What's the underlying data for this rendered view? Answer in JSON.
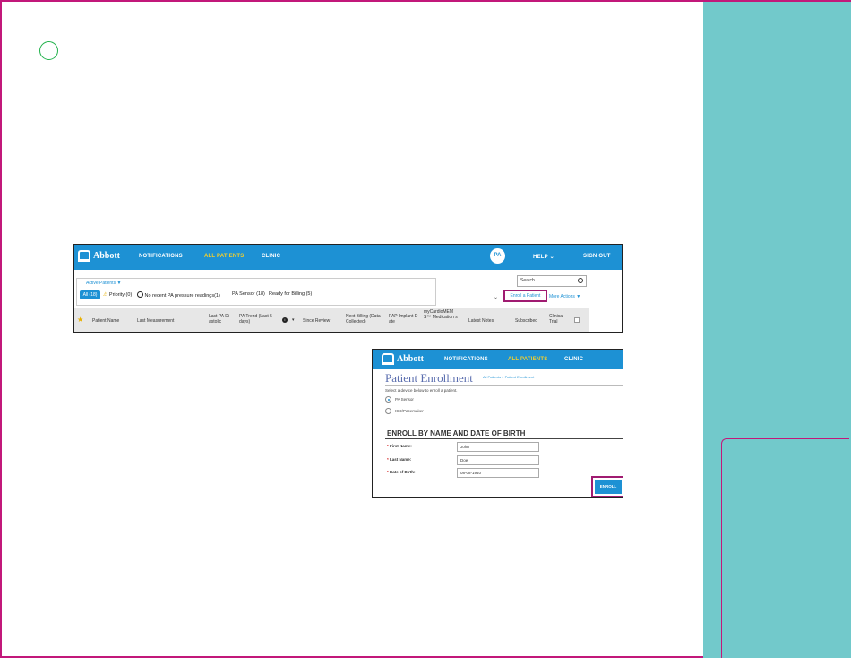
{
  "app": {
    "logo_text": "Abbott",
    "nav": {
      "notifications": "NOTIFICATIONS",
      "all_patients": "ALL PATIENTS",
      "clinic": "CLINIC",
      "avatar": "PA",
      "help": "HELP",
      "help_chev": "⌄",
      "sign_out": "SIGN OUT"
    }
  },
  "patient_list": {
    "active_patients": "Active Patients ▼",
    "filters": {
      "all": "All (18)",
      "priority": "Priority (0)",
      "no_recent": "No recent PA pressure readings(1)",
      "pa_sensor": "PA Sensor (18)",
      "ready_billing": "Ready for Billing (5)"
    },
    "search_placeholder": "Search",
    "enroll_link": "Enroll a Patient",
    "more_actions": "More Actions ▼",
    "collapse_icon": "⌄",
    "columns": {
      "patient_name": "Patient Name",
      "last_measurement": "Last Measurement",
      "last_pa_diastolic": "Last PA Di astolic",
      "pa_trend": "PA Trend (Last 5 days)",
      "info": "i",
      "sort_icon": "▾",
      "since_review": "Since Review",
      "next_billing": "Next Billing (Data Collected)",
      "pap_implant": "PAP Implant D ate",
      "medication": "myCardioMEM S™ Medication s",
      "latest_notes": "Latest Notes",
      "subscribed": "Subscribed",
      "clinical_trial": "Clinical Trial"
    }
  },
  "enrollment": {
    "title": "Patient Enrollment",
    "breadcrumb": "All Patients > Patient Enrollment",
    "instruction": "Select a device below to enroll a patient.",
    "devices": [
      "PA Sensor",
      "ICD/Pacemaker"
    ],
    "selected_device": "PA Sensor",
    "section_title": "ENROLL BY NAME AND DATE OF BIRTH",
    "required_mark": "*",
    "fields": [
      {
        "label": "First Name:",
        "value": "John"
      },
      {
        "label": "Last Name:",
        "value": "Doe"
      },
      {
        "label": "Date of Birth:",
        "value": "08-08-1940"
      }
    ],
    "enroll_button": "ENROLL"
  },
  "colors": {
    "nav_blue": "#1d91d4",
    "active_yellow": "#f5cf2b",
    "highlight": "#a01b71",
    "teal": "#72c9cb",
    "circle_green": "#22b24c"
  }
}
